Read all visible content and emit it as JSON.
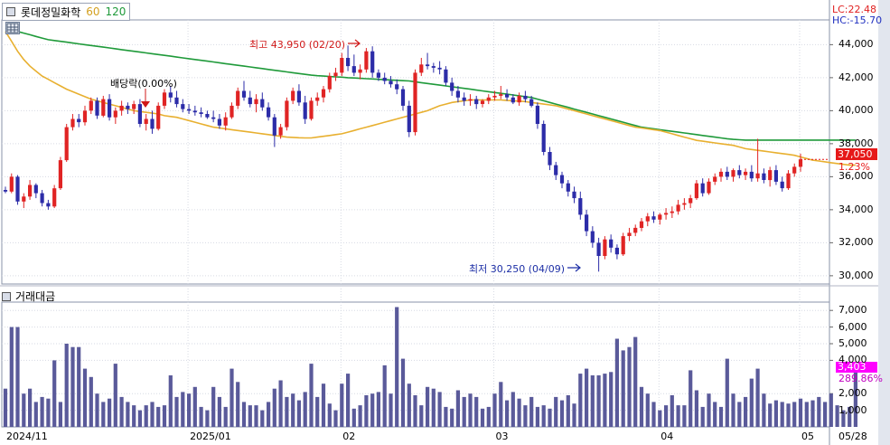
{
  "header": {
    "stock_name": "롯데정밀화학",
    "ma60_label": "60",
    "ma120_label": "120",
    "lc_label": "LC:22.48",
    "hc_label": "HC:-15.70"
  },
  "volume_panel": {
    "title": "거래대금",
    "current_value": "3,403",
    "current_pct": "289.86%",
    "yticks": [
      "7,000",
      "6,000",
      "5,000",
      "4,000",
      "2,000",
      "1,000"
    ]
  },
  "price_panel": {
    "current_price": "37,050",
    "current_pct": "1.23%",
    "yticks": [
      "44,000",
      "42,000",
      "40,000",
      "38,000",
      "36,000",
      "34,000",
      "32,000",
      "30,000"
    ]
  },
  "annotations": {
    "high": "최고 43,950 (02/20)",
    "low": "최저 30,250 (04/09)",
    "dividend": "배당락(0.00%)"
  },
  "x_axis": [
    "2024/11",
    "2025/01",
    "02",
    "03",
    "04",
    "05",
    "05/28"
  ],
  "colors": {
    "up": "#e02424",
    "down": "#2c2ca8",
    "ma60": "#e8b030",
    "ma120": "#1f9a3a",
    "volume": "#5a5a9a"
  },
  "chart_data": {
    "type": "candlestick",
    "ylim": [
      29500,
      45500
    ],
    "volume_ylim": [
      0,
      7500
    ],
    "candles": [
      [
        35200,
        35400,
        35000,
        35100
      ],
      [
        35100,
        36200,
        35000,
        36000
      ],
      [
        36000,
        36100,
        34300,
        34500
      ],
      [
        34500,
        35000,
        34100,
        34800
      ],
      [
        34800,
        35800,
        34600,
        35500
      ],
      [
        35500,
        35600,
        34700,
        35000
      ],
      [
        35000,
        35200,
        34200,
        34400
      ],
      [
        34400,
        34600,
        34000,
        34200
      ],
      [
        34200,
        35500,
        34100,
        35300
      ],
      [
        35300,
        37200,
        35200,
        37000
      ],
      [
        37000,
        39200,
        36900,
        39000
      ],
      [
        39000,
        39800,
        38800,
        39500
      ],
      [
        39500,
        39800,
        39000,
        39300
      ],
      [
        39300,
        40300,
        39100,
        40000
      ],
      [
        40000,
        40800,
        39800,
        40600
      ],
      [
        40600,
        40800,
        39500,
        39700
      ],
      [
        39700,
        40900,
        39600,
        40700
      ],
      [
        40700,
        41000,
        39400,
        39600
      ],
      [
        39600,
        40200,
        39200,
        40000
      ],
      [
        40000,
        40600,
        39700,
        40300
      ],
      [
        40300,
        40500,
        39800,
        40100
      ],
      [
        40100,
        40600,
        39800,
        40400
      ],
      [
        40400,
        40700,
        39000,
        39200
      ],
      [
        39200,
        39800,
        38800,
        39500
      ],
      [
        39500,
        40000,
        38600,
        38900
      ],
      [
        38900,
        40500,
        38800,
        40300
      ],
      [
        40300,
        41300,
        40100,
        41100
      ],
      [
        41100,
        41500,
        40500,
        40800
      ],
      [
        40800,
        41200,
        40200,
        40400
      ],
      [
        40400,
        40700,
        39900,
        40100
      ],
      [
        40100,
        40400,
        39800,
        40000
      ],
      [
        40000,
        40300,
        39700,
        39900
      ],
      [
        39900,
        40200,
        39600,
        39800
      ],
      [
        39800,
        40000,
        39500,
        39600
      ],
      [
        39600,
        40000,
        39300,
        39500
      ],
      [
        39500,
        39800,
        38900,
        39100
      ],
      [
        39100,
        39900,
        38800,
        39600
      ],
      [
        39600,
        40500,
        39500,
        40300
      ],
      [
        40300,
        41400,
        40100,
        41200
      ],
      [
        41200,
        41800,
        40600,
        40800
      ],
      [
        40800,
        41200,
        40200,
        40400
      ],
      [
        40400,
        41000,
        39900,
        40700
      ],
      [
        40700,
        41100,
        40000,
        40200
      ],
      [
        40200,
        40500,
        39400,
        39600
      ],
      [
        39600,
        39800,
        37800,
        38500
      ],
      [
        38500,
        39200,
        38300,
        39000
      ],
      [
        39000,
        40800,
        38800,
        40600
      ],
      [
        40600,
        41400,
        40400,
        41200
      ],
      [
        41200,
        41600,
        40300,
        40500
      ],
      [
        40500,
        40900,
        39200,
        39500
      ],
      [
        39500,
        40800,
        39400,
        40600
      ],
      [
        40600,
        41100,
        40300,
        40800
      ],
      [
        40800,
        41500,
        40500,
        41300
      ],
      [
        41300,
        42300,
        41100,
        42100
      ],
      [
        42100,
        42600,
        41800,
        42300
      ],
      [
        42300,
        43500,
        42100,
        43200
      ],
      [
        43200,
        43950,
        42400,
        42700
      ],
      [
        42700,
        43400,
        42100,
        42300
      ],
      [
        42300,
        42800,
        41900,
        42500
      ],
      [
        42500,
        43800,
        42300,
        43600
      ],
      [
        43600,
        43900,
        42000,
        42300
      ],
      [
        42300,
        42500,
        41800,
        42000
      ],
      [
        42000,
        42300,
        41600,
        41800
      ],
      [
        41800,
        42100,
        41400,
        41600
      ],
      [
        41600,
        41900,
        41000,
        41300
      ],
      [
        41300,
        41500,
        40000,
        40300
      ],
      [
        40300,
        40600,
        38400,
        38700
      ],
      [
        38700,
        42500,
        38500,
        42300
      ],
      [
        42300,
        43200,
        42100,
        42800
      ],
      [
        42800,
        43500,
        42500,
        42700
      ],
      [
        42700,
        42900,
        42300,
        42600
      ],
      [
        42600,
        43000,
        42200,
        42500
      ],
      [
        42500,
        42700,
        41500,
        41700
      ],
      [
        41700,
        42000,
        40900,
        41200
      ],
      [
        41200,
        41500,
        40500,
        40800
      ],
      [
        40800,
        41100,
        40300,
        40600
      ],
      [
        40600,
        41000,
        40300,
        40700
      ],
      [
        40700,
        40900,
        40100,
        40400
      ],
      [
        40400,
        40700,
        40200,
        40600
      ],
      [
        40600,
        41000,
        40400,
        40800
      ],
      [
        40800,
        41200,
        40600,
        40900
      ],
      [
        40900,
        41500,
        40700,
        41000
      ],
      [
        41000,
        41300,
        40600,
        40800
      ],
      [
        40800,
        41000,
        40400,
        40500
      ],
      [
        40500,
        41100,
        40300,
        40900
      ],
      [
        40900,
        41200,
        40500,
        40700
      ],
      [
        40700,
        40900,
        40200,
        40300
      ],
      [
        40300,
        40500,
        38900,
        39200
      ],
      [
        39200,
        39400,
        37300,
        37500
      ],
      [
        37500,
        37800,
        36400,
        36700
      ],
      [
        36700,
        36900,
        35800,
        36100
      ],
      [
        36100,
        36300,
        35300,
        35600
      ],
      [
        35600,
        35800,
        34800,
        35100
      ],
      [
        35100,
        35400,
        34400,
        34700
      ],
      [
        34700,
        35100,
        33400,
        33700
      ],
      [
        33700,
        34000,
        32400,
        32700
      ],
      [
        32700,
        33000,
        31700,
        32000
      ],
      [
        32000,
        32300,
        30250,
        31200
      ],
      [
        31200,
        32400,
        31000,
        32200
      ],
      [
        32200,
        32500,
        31400,
        31700
      ],
      [
        31700,
        31900,
        31000,
        31300
      ],
      [
        31300,
        32600,
        31200,
        32400
      ],
      [
        32400,
        32900,
        32100,
        32600
      ],
      [
        32600,
        33100,
        32400,
        32900
      ],
      [
        32900,
        33500,
        32700,
        33300
      ],
      [
        33300,
        33800,
        33000,
        33600
      ],
      [
        33600,
        33900,
        33200,
        33400
      ],
      [
        33400,
        33800,
        33100,
        33700
      ],
      [
        33700,
        34100,
        33400,
        33800
      ],
      [
        33800,
        34200,
        33500,
        33900
      ],
      [
        33900,
        34600,
        33700,
        34300
      ],
      [
        34300,
        34700,
        34000,
        34400
      ],
      [
        34400,
        34900,
        34100,
        34700
      ],
      [
        34700,
        35800,
        34600,
        35600
      ],
      [
        35600,
        35900,
        34800,
        35000
      ],
      [
        35000,
        35900,
        34900,
        35700
      ],
      [
        35700,
        36200,
        35500,
        36000
      ],
      [
        36000,
        36500,
        35700,
        36300
      ],
      [
        36300,
        36600,
        35800,
        36000
      ],
      [
        36000,
        36500,
        35700,
        36400
      ],
      [
        36400,
        36700,
        35900,
        36100
      ],
      [
        36100,
        36500,
        35800,
        36300
      ],
      [
        36300,
        36700,
        35700,
        35900
      ],
      [
        35900,
        38300,
        35700,
        36200
      ],
      [
        36200,
        36500,
        35600,
        35800
      ],
      [
        35800,
        36600,
        35400,
        36400
      ],
      [
        36400,
        36700,
        35500,
        35700
      ],
      [
        35700,
        36000,
        35100,
        35300
      ],
      [
        35300,
        36400,
        35200,
        36200
      ],
      [
        36200,
        36800,
        36000,
        36600
      ],
      [
        36600,
        37400,
        36300,
        37050
      ]
    ],
    "volume": [
      2300,
      6000,
      6000,
      2000,
      2300,
      1500,
      1800,
      1700,
      4000,
      1500,
      5000,
      4800,
      4800,
      3500,
      3000,
      2000,
      1500,
      1700,
      3800,
      1800,
      1500,
      1300,
      1000,
      1300,
      1500,
      1200,
      1300,
      3100,
      1800,
      2100,
      2000,
      2400,
      1200,
      1000,
      2400,
      1800,
      1200,
      3500,
      2700,
      1500,
      1300,
      1300,
      1000,
      1500,
      2300,
      2800,
      1800,
      2000,
      1600,
      2100,
      3800,
      1800,
      2600,
      1400,
      1000,
      2600,
      3200,
      1100,
      1300,
      1900,
      2000,
      2100,
      3700,
      2000,
      7200,
      4100,
      2600,
      1900,
      1300,
      2400,
      2300,
      2100,
      1200,
      1100,
      2200,
      1800,
      2000,
      1800,
      1100,
      1200,
      2000,
      2700,
      1600,
      2100,
      1700,
      1300,
      1800,
      1200,
      1300,
      1100,
      1800,
      1600,
      1900,
      1400,
      3200,
      3500,
      3100,
      3100,
      3200,
      3300,
      5300,
      4600,
      4800,
      5400,
      2400,
      2000,
      1500,
      1000,
      1300,
      1900,
      1300,
      1300,
      3400,
      2200,
      1200,
      2000,
      1500,
      1200,
      4100,
      2000,
      1500,
      1800,
      2900,
      3500,
      2000,
      1400,
      1600,
      1500,
      1400,
      1500,
      1700,
      1500,
      1600,
      1800,
      1500,
      2000,
      1300,
      1000,
      1200,
      3403
    ],
    "ma60": [
      44800,
      44200,
      43600,
      43100,
      42700,
      42400,
      42100,
      41900,
      41700,
      41500,
      41300,
      41150,
      41000,
      40850,
      40700,
      40600,
      40500,
      40400,
      40300,
      40200,
      40100,
      40000,
      39950,
      39900,
      39850,
      39800,
      39700,
      39650,
      39600,
      39500,
      39400,
      39300,
      39200,
      39100,
      39000,
      38950,
      38900,
      38850,
      38800,
      38750,
      38700,
      38650,
      38600,
      38550,
      38500,
      38450,
      38400,
      38380,
      38360,
      38350,
      38350,
      38400,
      38450,
      38500,
      38550,
      38600,
      38700,
      38800,
      38900,
      39000,
      39100,
      39200,
      39300,
      39400,
      39500,
      39600,
      39700,
      39800,
      39900,
      40000,
      40150,
      40300,
      40400,
      40500,
      40550,
      40600,
      40650,
      40650,
      40650,
      40650,
      40650,
      40650,
      40620,
      40600,
      40580,
      40550,
      40500,
      40450,
      40400,
      40350,
      40300,
      40200,
      40100,
      40000,
      39900,
      39800,
      39700,
      39600,
      39500,
      39400,
      39300,
      39200,
      39100,
      39000,
      38950,
      38900,
      38850,
      38800,
      38700,
      38600,
      38500,
      38400,
      38300,
      38200,
      38150,
      38100,
      38050,
      38000,
      37950,
      37900,
      37800,
      37700,
      37650,
      37600,
      37550,
      37500,
      37450,
      37400,
      37350,
      37300,
      37200,
      37100,
      37000,
      36950,
      36900,
      36850,
      36800,
      36750,
      36700,
      36700
    ],
    "ma120": [
      45000,
      44900,
      44800,
      44700,
      44600,
      44500,
      44400,
      44300,
      44250,
      44200,
      44150,
      44100,
      44050,
      44000,
      43950,
      43900,
      43850,
      43800,
      43750,
      43700,
      43650,
      43600,
      43550,
      43500,
      43450,
      43400,
      43350,
      43300,
      43250,
      43200,
      43150,
      43100,
      43050,
      43000,
      42950,
      42900,
      42850,
      42800,
      42750,
      42700,
      42650,
      42600,
      42550,
      42500,
      42450,
      42400,
      42350,
      42300,
      42250,
      42200,
      42150,
      42120,
      42100,
      42070,
      42050,
      42030,
      42000,
      41980,
      41960,
      41940,
      41920,
      41900,
      41880,
      41860,
      41840,
      41820,
      41800,
      41750,
      41700,
      41650,
      41600,
      41550,
      41500,
      41450,
      41400,
      41350,
      41300,
      41250,
      41200,
      41150,
      41100,
      41050,
      41000,
      40950,
      40900,
      40850,
      40800,
      40700,
      40600,
      40500,
      40400,
      40300,
      40200,
      40100,
      40000,
      39900,
      39800,
      39700,
      39600,
      39500,
      39400,
      39300,
      39200,
      39100,
      39000,
      38950,
      38900,
      38850,
      38800,
      38750,
      38700,
      38650,
      38600,
      38550,
      38500,
      38450,
      38400,
      38350,
      38300,
      38260,
      38240,
      38220,
      38220,
      38220,
      38220,
      38220,
      38220,
      38220,
      38220,
      38220,
      38220,
      38220,
      38220,
      38220,
      38220,
      38220,
      38220,
      38220,
      38220,
      38220
    ]
  }
}
